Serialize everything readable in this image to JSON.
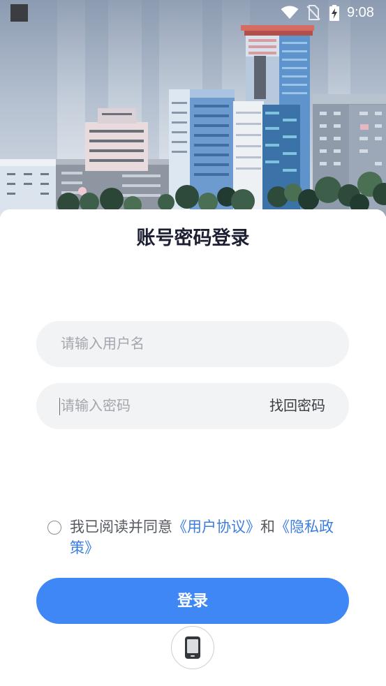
{
  "status_bar": {
    "time": "9:08",
    "icons": [
      "notification-icon",
      "wifi-icon",
      "no-sim-icon",
      "battery-charging-icon"
    ]
  },
  "login": {
    "title": "账号密码登录",
    "username": {
      "placeholder": "请输入用户名",
      "value": ""
    },
    "password": {
      "placeholder": "请输入密码",
      "value": ""
    },
    "forgot_password": "找回密码",
    "agreement": {
      "checked": false,
      "prefix": "我已阅读并同意",
      "user_agreement_link": "《用户协议》",
      "conjunction": "和",
      "privacy_policy_link": "《隐私政策》"
    },
    "submit_label": "登录",
    "alternate_login_icon": "mobile-phone-icon"
  },
  "colors": {
    "accent": "#3f87f5",
    "link": "#3b7de0",
    "title": "#1d1f33",
    "input_bg": "#f2f3f5",
    "placeholder": "#a2a6ad"
  }
}
